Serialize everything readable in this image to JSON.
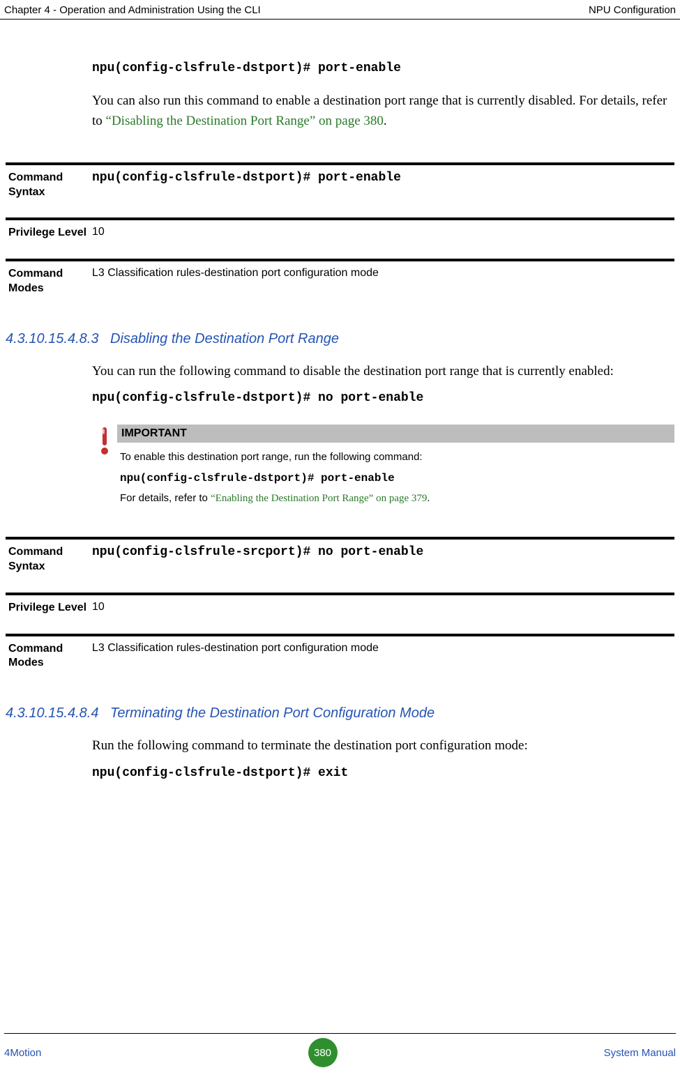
{
  "header": {
    "left": "Chapter 4 - Operation and Administration Using the CLI",
    "right": "NPU Configuration"
  },
  "intro": {
    "cmd": "npu(config-clsfrule-dstport)# port-enable",
    "para_a": "You can also run this command to enable a destination port range that is currently disabled. For details, refer to ",
    "link": "“Disabling the Destination Port Range” on page 380",
    "para_b": "."
  },
  "block1": {
    "rows": [
      {
        "label": "Command Syntax",
        "value": "npu(config-clsfrule-dstport)# port-enable",
        "mono": true
      },
      {
        "label": "Privilege Level",
        "value": "10",
        "mono": false
      },
      {
        "label": "Command Modes",
        "value": "L3 Classification rules-destination port configuration mode",
        "mono": false
      }
    ]
  },
  "sub1": {
    "num": "4.3.10.15.4.8.3",
    "title": "Disabling the Destination Port Range",
    "para": "You can run the following command to disable the destination port range that is currently enabled:",
    "cmd": "npu(config-clsfrule-dstport)# no port-enable"
  },
  "note": {
    "title": "IMPORTANT",
    "line1": "To enable this destination port range, run the following command:",
    "cmd": "npu(config-clsfrule-dstport)# port-enable",
    "line2a": "For details, refer to ",
    "link": "“Enabling the Destination Port Range” on page 379",
    "line2b": "."
  },
  "block2": {
    "rows": [
      {
        "label": "Command Syntax",
        "value": "npu(config-clsfrule-srcport)# no port-enable",
        "mono": true
      },
      {
        "label": "Privilege Level",
        "value": "10",
        "mono": false
      },
      {
        "label": "Command Modes",
        "value": "L3 Classification rules-destination port configuration mode",
        "mono": false
      }
    ]
  },
  "sub2": {
    "num": "4.3.10.15.4.8.4",
    "title": "Terminating the Destination Port Configuration Mode",
    "para": "Run the following command to terminate the destination port configuration mode:",
    "cmd": "npu(config-clsfrule-dstport)# exit"
  },
  "footer": {
    "left": "4Motion",
    "page": "380",
    "right": "System Manual"
  }
}
